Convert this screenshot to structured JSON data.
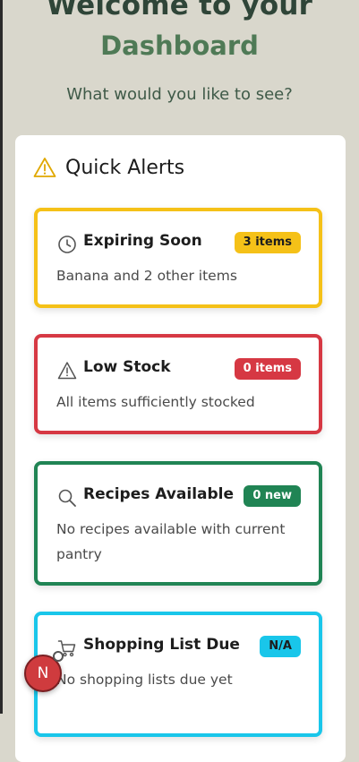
{
  "hero": {
    "title_line1": "Welcome to your",
    "title_line2": "Dashboard",
    "subtitle": "What would you like to see?"
  },
  "quick_alerts": {
    "title": "Quick Alerts",
    "icon": "warning-triangle-icon",
    "cards": [
      {
        "title": "Expiring Soon",
        "icon": "clock-icon",
        "badge": "3 items",
        "description": "Banana and 2 other items",
        "border_color": "#f5c118",
        "badge_bg": "#f5c118",
        "badge_text_color": "#1d1d1d"
      },
      {
        "title": "Low Stock",
        "icon": "warning-triangle-icon",
        "badge": "0 items",
        "description": "All items sufficiently stocked",
        "border_color": "#d63843",
        "badge_bg": "#d63843",
        "badge_text_color": "#ffffff"
      },
      {
        "title": "Recipes Available",
        "icon": "search-icon",
        "badge": "0 new",
        "description": "No recipes available with current pantry",
        "border_color": "#208454",
        "badge_bg": "#208454",
        "badge_text_color": "#ffffff"
      },
      {
        "title": "Shopping List Due",
        "icon": "cart-icon",
        "badge": "N/A",
        "description": "No shopping lists due yet",
        "border_color": "#19c6ea",
        "badge_bg": "#19c6ea",
        "badge_text_color": "#1d1d1d"
      }
    ]
  },
  "fab": {
    "label": "N",
    "icon": "notification-avatar-icon"
  }
}
